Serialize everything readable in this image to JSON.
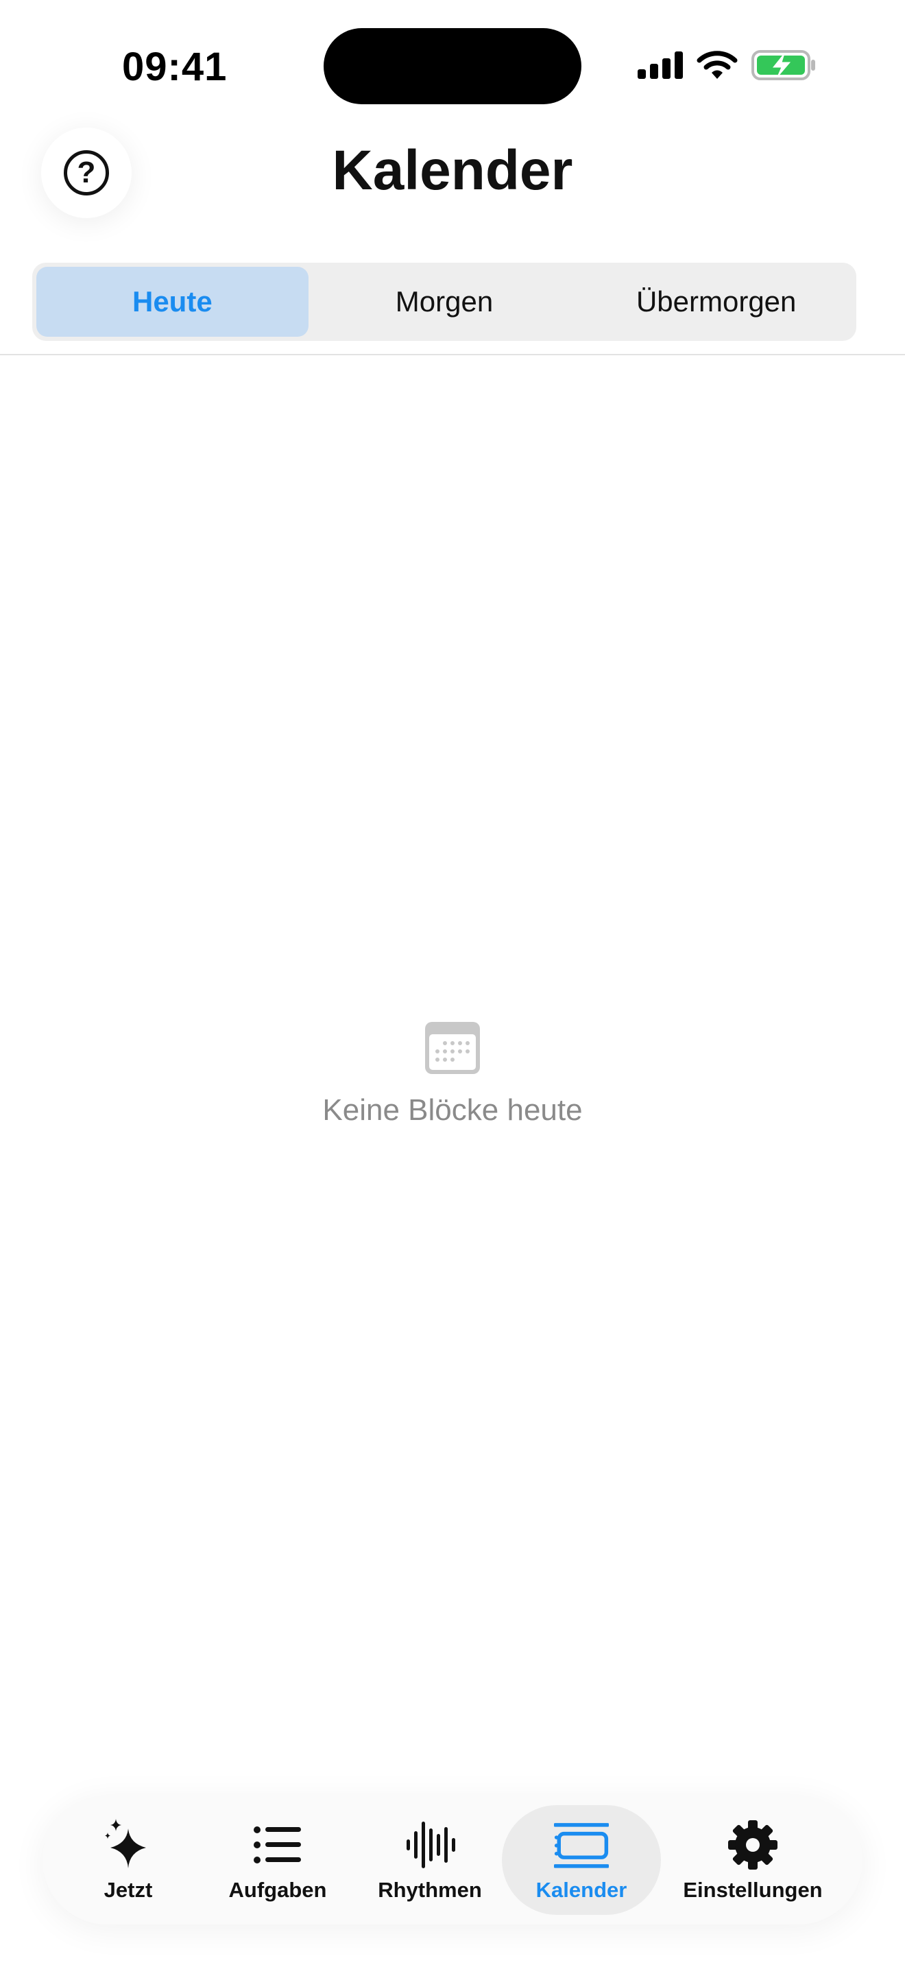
{
  "status_bar": {
    "time": "09:41"
  },
  "header": {
    "title": "Kalender",
    "help_icon": "question-circle-icon"
  },
  "segments": [
    {
      "label": "Heute",
      "active": true
    },
    {
      "label": "Morgen",
      "active": false
    },
    {
      "label": "Übermorgen",
      "active": false
    }
  ],
  "empty_state": {
    "icon": "calendar-icon",
    "text": "Keine Blöcke heute"
  },
  "tab_bar": {
    "items": [
      {
        "label": "Jetzt",
        "icon": "sparkles-icon",
        "active": false
      },
      {
        "label": "Aufgaben",
        "icon": "list-icon",
        "active": false
      },
      {
        "label": "Rhythmen",
        "icon": "waveform-icon",
        "active": false
      },
      {
        "label": "Kalender",
        "icon": "calendar-blocks-icon",
        "active": true
      },
      {
        "label": "Einstellungen",
        "icon": "gear-icon",
        "active": false
      }
    ]
  },
  "colors": {
    "accent": "#1a8cf0",
    "segment_active_bg": "#c7dcf2",
    "battery_green": "#34c759",
    "muted_text": "#8a8a8a"
  }
}
